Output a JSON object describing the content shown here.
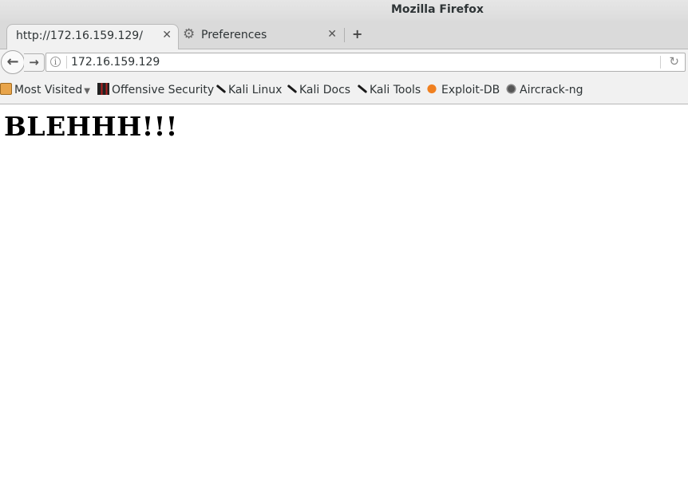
{
  "window": {
    "title": "Mozilla Firefox"
  },
  "tabs": [
    {
      "label": "http://172.16.159.129/",
      "active": true
    },
    {
      "label": "Preferences",
      "active": false,
      "icon": "gear-icon"
    }
  ],
  "new_tab_glyph": "+",
  "nav": {
    "back_glyph": "←",
    "forward_glyph": "→",
    "url": "172.16.159.129",
    "info_glyph": "i",
    "reload_glyph": "↻"
  },
  "bookmarks": [
    {
      "label": "Most Visited",
      "icon": "folder-icon",
      "dropdown": "▼"
    },
    {
      "label": "Offensive Security",
      "icon": "offensive-security-icon"
    },
    {
      "label": "Kali Linux",
      "icon": "kali-dragon-icon"
    },
    {
      "label": "Kali Docs",
      "icon": "kali-dragon-icon"
    },
    {
      "label": "Kali Tools",
      "icon": "kali-dragon-icon"
    },
    {
      "label": "Exploit-DB",
      "icon": "exploit-db-icon"
    },
    {
      "label": "Aircrack-ng",
      "icon": "aircrack-icon"
    }
  ],
  "page": {
    "heading": "BLEHHH!!!"
  }
}
